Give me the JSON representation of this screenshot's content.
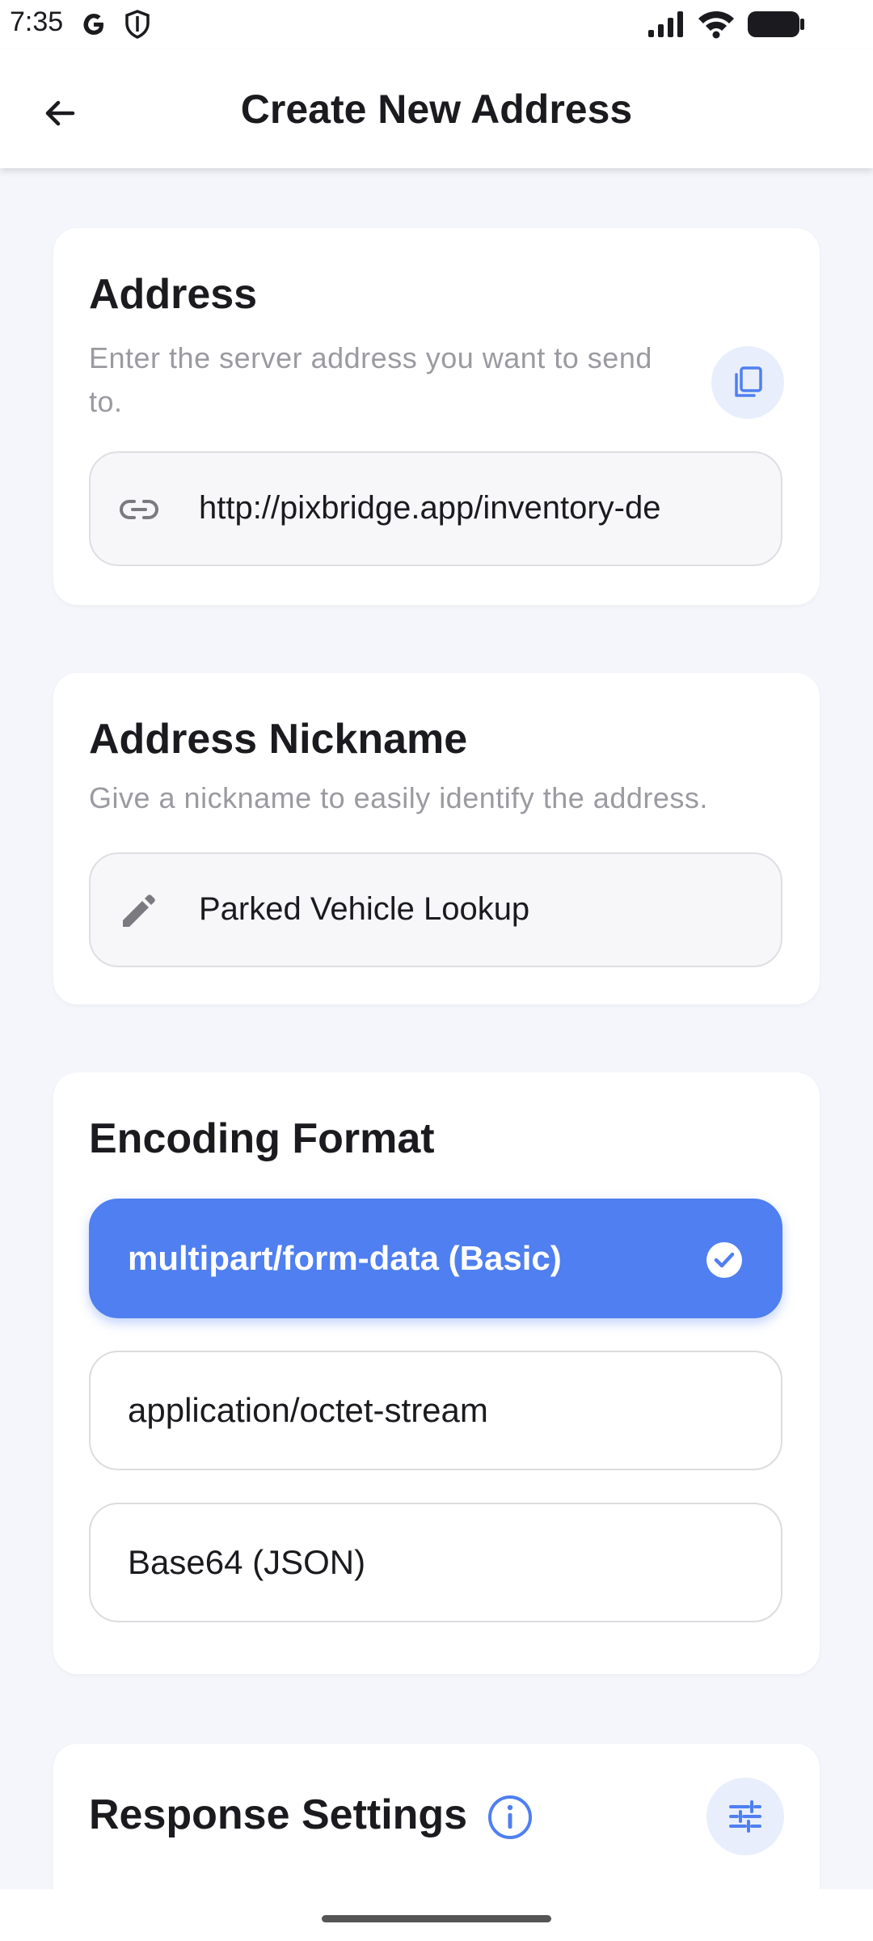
{
  "status_bar": {
    "time": "7:35"
  },
  "app_bar": {
    "title": "Create New Address"
  },
  "address_card": {
    "title": "Address",
    "description": "Enter the server address you want to send to.",
    "value": "http://pixbridge.app/inventory-de"
  },
  "nickname_card": {
    "title": "Address Nickname",
    "description": "Give a nickname to easily identify the address.",
    "value": "Parked Vehicle Lookup"
  },
  "encoding_card": {
    "title": "Encoding Format",
    "options": [
      {
        "label": "multipart/form-data (Basic)",
        "selected": true
      },
      {
        "label": "application/octet-stream",
        "selected": false
      },
      {
        "label": "Base64 (JSON)",
        "selected": false
      }
    ]
  },
  "response_card": {
    "title": "Response Settings"
  },
  "colors": {
    "accent": "#4f7ff0",
    "background": "#f4f6fb"
  },
  "icons": [
    "back-arrow-icon",
    "link-icon",
    "copy-icon",
    "pencil-icon",
    "check-circle-icon",
    "info-icon",
    "tune-icon"
  ]
}
